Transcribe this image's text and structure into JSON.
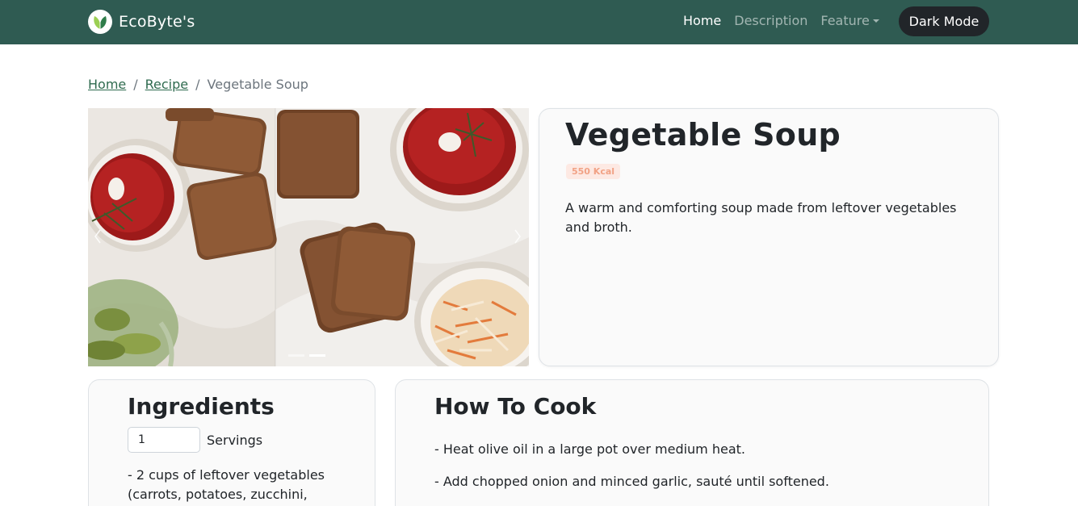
{
  "navbar": {
    "brand": "EcoByte's",
    "links": [
      {
        "label": "Home"
      },
      {
        "label": "Description"
      },
      {
        "label": "Feature"
      }
    ],
    "dark_mode_label": "Dark Mode",
    "background": "#2f5b52"
  },
  "breadcrumb": {
    "home": "Home",
    "recipe": "Recipe",
    "current": "Vegetable Soup",
    "separator": "/"
  },
  "carousel": {
    "prev_icon": "chevron-left-icon",
    "next_icon": "chevron-right-icon",
    "slide_count": 2,
    "active_slide": 2,
    "image_description": "borscht soup with rye bread and pickles"
  },
  "recipe": {
    "title": "Vegetable Soup",
    "kcal": "550 Kcal",
    "description": "A warm and comforting soup made from leftover vegetables and broth."
  },
  "ingredients": {
    "heading": "Ingredients",
    "servings_value": "1",
    "servings_label": "Servings",
    "items": [
      "- 2 cups of leftover vegetables (carrots, potatoes, zucchini,"
    ]
  },
  "how_to_cook": {
    "heading": "How To Cook",
    "steps": [
      "- Heat olive oil in a large pot over medium heat.",
      "- Add chopped onion and minced garlic, sauté until softened."
    ]
  },
  "colors": {
    "accent": "#2f6b4f",
    "badge_bg": "#fde9e3",
    "badge_text": "#f1a285",
    "dark_button": "#212529"
  }
}
